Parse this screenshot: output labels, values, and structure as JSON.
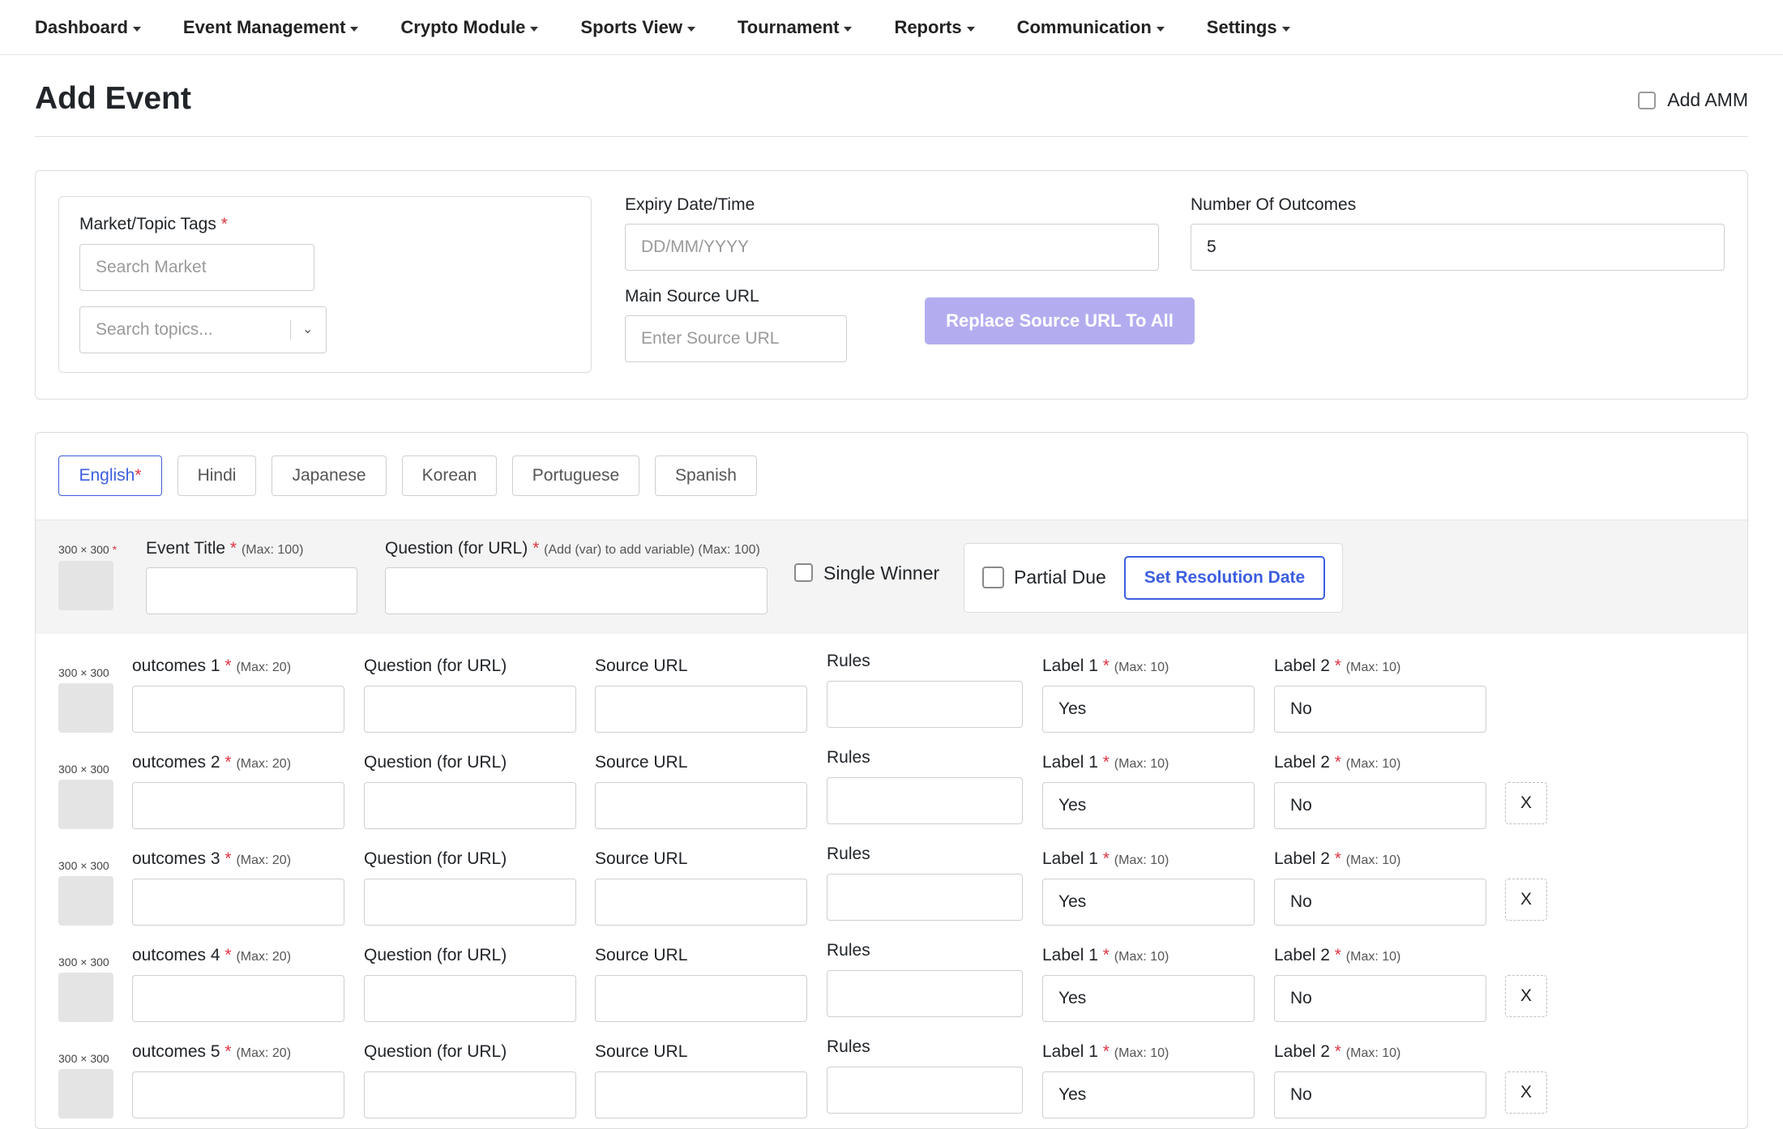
{
  "nav": {
    "items": [
      {
        "label": "Dashboard"
      },
      {
        "label": "Event Management"
      },
      {
        "label": "Crypto Module"
      },
      {
        "label": "Sports View"
      },
      {
        "label": "Tournament"
      },
      {
        "label": "Reports"
      },
      {
        "label": "Communication"
      },
      {
        "label": "Settings"
      }
    ]
  },
  "header": {
    "title": "Add Event",
    "amm_label": "Add AMM"
  },
  "market": {
    "label": "Market/Topic Tags",
    "required": "*",
    "search_placeholder": "Search Market",
    "topics_placeholder": "Search topics...",
    "chevron": "⌄"
  },
  "expiry": {
    "label": "Expiry Date/Time",
    "placeholder": "DD/MM/YYYY"
  },
  "outcomes_count": {
    "label": "Number Of Outcomes",
    "value": "5"
  },
  "source": {
    "label": "Main Source URL",
    "placeholder": "Enter Source URL",
    "replace_button": "Replace Source URL To All"
  },
  "languages": {
    "tabs": [
      {
        "label": "English",
        "suffix": "*"
      },
      {
        "label": "Hindi",
        "suffix": ""
      },
      {
        "label": "Japanese",
        "suffix": ""
      },
      {
        "label": "Korean",
        "suffix": ""
      },
      {
        "label": "Portuguese",
        "suffix": ""
      },
      {
        "label": "Spanish",
        "suffix": ""
      }
    ]
  },
  "event": {
    "image_label": "300 × 300",
    "image_required": "*",
    "title_label": "Event Title",
    "title_hint": "(Max: 100)",
    "question_label": "Question (for URL)",
    "question_hint": "(Add (var) to add variable) (Max: 100)",
    "single_winner": "Single Winner",
    "partial_due": "Partial Due",
    "resolution_button": "Set Resolution Date"
  },
  "outcome_labels": {
    "image_label": "300 × 300",
    "outcome_prefix": "outcomes",
    "outcome_hint": "(Max: 20)",
    "question": "Question (for URL)",
    "source": "Source URL",
    "rules": "Rules",
    "label1": "Label 1",
    "label2": "Label 2",
    "label_hint": "(Max: 10)",
    "remove": "X"
  },
  "outcomes": [
    {
      "number": "1",
      "label1_value": "Yes",
      "label2_value": "No"
    },
    {
      "number": "2",
      "label1_value": "Yes",
      "label2_value": "No"
    },
    {
      "number": "3",
      "label1_value": "Yes",
      "label2_value": "No"
    },
    {
      "number": "4",
      "label1_value": "Yes",
      "label2_value": "No"
    },
    {
      "number": "5",
      "label1_value": "Yes",
      "label2_value": "No"
    }
  ],
  "colors": {
    "accent": "#3d5ee0",
    "accent_light": "#b3adf0",
    "required": "#dc3545"
  }
}
